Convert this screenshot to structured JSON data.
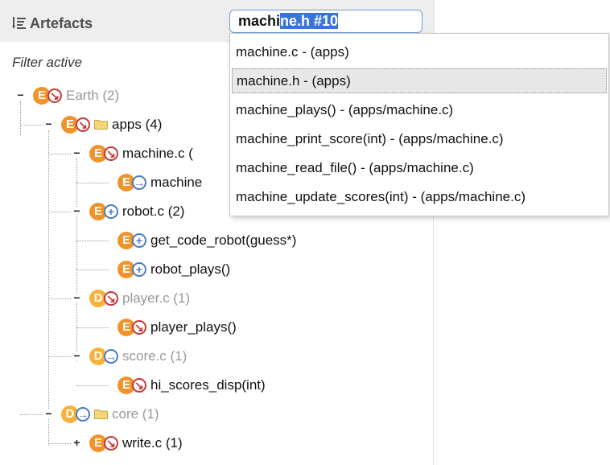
{
  "header": {
    "title": "Artefacts",
    "search_value_typed": "machi",
    "search_value_autocompleted": "ne.h #10"
  },
  "filter_note": "Filter active",
  "autocomplete": [
    "machine.c - (apps)",
    "machine.h - (apps)",
    "machine_plays() - (apps/machine.c)",
    "machine_print_score(int) - (apps/machine.c)",
    "machine_read_file() - (apps/machine.c)",
    "machine_update_scores(int) - (apps/machine.c)"
  ],
  "tree": [
    {
      "label": "Earth (2)",
      "badge": "E",
      "status": "down-red",
      "toggle": "−",
      "folder": false,
      "dim": true
    },
    {
      "label": "apps (4)",
      "badge": "E",
      "status": "down-red",
      "toggle": "−",
      "folder": true,
      "dim": false
    },
    {
      "label": "machine.c (",
      "badge": "E",
      "status": "down-red",
      "toggle": "−",
      "folder": false,
      "dim": false
    },
    {
      "label": "machine",
      "badge": "E",
      "status": "right-blue",
      "toggle": "",
      "folder": false,
      "dim": false
    },
    {
      "label": "robot.c (2)",
      "badge": "E",
      "status": "plus-blue",
      "toggle": "−",
      "folder": false,
      "dim": false
    },
    {
      "label": "get_code_robot(guess*)",
      "badge": "E",
      "status": "plus-blue",
      "toggle": "",
      "folder": false,
      "dim": false
    },
    {
      "label": "robot_plays()",
      "badge": "E",
      "status": "plus-blue",
      "toggle": "",
      "folder": false,
      "dim": false
    },
    {
      "label": "player.c (1)",
      "badge": "D",
      "status": "down-red",
      "toggle": "−",
      "folder": false,
      "dim": true
    },
    {
      "label": "player_plays()",
      "badge": "E",
      "status": "down-red",
      "toggle": "",
      "folder": false,
      "dim": false
    },
    {
      "label": "score.c (1)",
      "badge": "D",
      "status": "right-blue",
      "toggle": "−",
      "folder": false,
      "dim": true
    },
    {
      "label": "hi_scores_disp(int)",
      "badge": "E",
      "status": "down-red",
      "toggle": "",
      "folder": false,
      "dim": false
    },
    {
      "label": "core (1)",
      "badge": "D",
      "status": "right-blue",
      "toggle": "−",
      "folder": true,
      "dim": true
    },
    {
      "label": "write.c (1)",
      "badge": "E",
      "status": "down-red",
      "toggle": "+",
      "folder": false,
      "dim": false
    }
  ],
  "colors": {
    "accent": "#3875d7",
    "badge_e": "#f0932a",
    "badge_d": "#f6b23a",
    "status_red": "#c43a3a",
    "status_blue": "#4a7cc0"
  }
}
